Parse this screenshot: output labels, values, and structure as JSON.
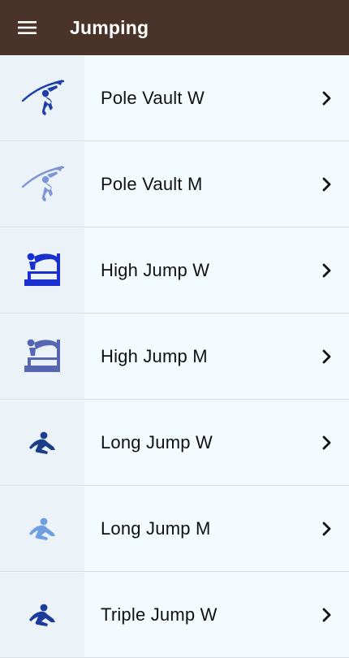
{
  "header": {
    "title": "Jumping",
    "menu_icon": "hamburger-menu-icon"
  },
  "events": [
    {
      "label": "Pole Vault W",
      "icon": "pole-vault-icon",
      "color": "#1f3fa8"
    },
    {
      "label": "Pole Vault M",
      "icon": "pole-vault-icon",
      "color": "#7f96d6"
    },
    {
      "label": "High Jump W",
      "icon": "high-jump-icon",
      "color": "#1a2fd0"
    },
    {
      "label": "High Jump M",
      "icon": "high-jump-icon",
      "color": "#5666b0"
    },
    {
      "label": "Long Jump W",
      "icon": "long-jump-icon",
      "color": "#1b3d8a"
    },
    {
      "label": "Long Jump M",
      "icon": "long-jump-icon",
      "color": "#6f9fe0"
    },
    {
      "label": "Triple Jump W",
      "icon": "triple-jump-icon",
      "color": "#1b3a9a"
    }
  ],
  "chevron_icon": "chevron-right-icon"
}
